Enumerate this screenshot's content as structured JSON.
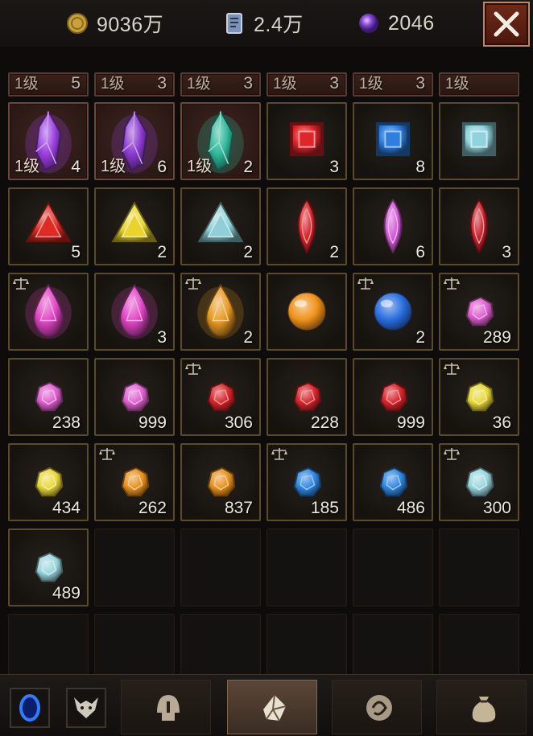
{
  "resources": {
    "gold": "9036万",
    "scroll": "2.4万",
    "orb": "2046"
  },
  "partial_row": [
    {
      "level": "1级",
      "qty": "5"
    },
    {
      "level": "1级",
      "qty": "3"
    },
    {
      "level": "1级",
      "qty": "3"
    },
    {
      "level": "1级",
      "qty": "3"
    },
    {
      "level": "1级",
      "qty": "3"
    },
    {
      "level": "1级",
      "qty": ""
    }
  ],
  "items": [
    {
      "name": "purple-crystal",
      "level": "1级",
      "qty": "4",
      "color": "#9b3fe0",
      "bound": false
    },
    {
      "name": "purple-crystal",
      "level": "1级",
      "qty": "6",
      "color": "#8a3ad0",
      "bound": false
    },
    {
      "name": "teal-crystal",
      "level": "1级",
      "qty": "2",
      "color": "#2fb89a",
      "bound": false
    },
    {
      "name": "red-square-gem",
      "level": "",
      "qty": "3",
      "color": "#e0262a",
      "bound": false
    },
    {
      "name": "blue-square-gem",
      "level": "",
      "qty": "8",
      "color": "#2f7fe0",
      "bound": false
    },
    {
      "name": "cyan-square-gem",
      "level": "",
      "qty": "",
      "color": "#8fd4dc",
      "bound": false
    },
    {
      "name": "red-triangle-gem",
      "level": "",
      "qty": "5",
      "color": "#e02a22",
      "bound": false
    },
    {
      "name": "yellow-triangle-gem",
      "level": "",
      "qty": "2",
      "color": "#e8d42c",
      "bound": false
    },
    {
      "name": "cyan-triangle-gem",
      "level": "",
      "qty": "2",
      "color": "#8fd0d8",
      "bound": false
    },
    {
      "name": "red-marquise-gem",
      "level": "",
      "qty": "2",
      "color": "#d8232a",
      "bound": false
    },
    {
      "name": "pink-marquise-gem",
      "level": "",
      "qty": "6",
      "color": "#d35ad8",
      "bound": false
    },
    {
      "name": "red-marquise-gem",
      "level": "",
      "qty": "3",
      "color": "#c8202a",
      "bound": false
    },
    {
      "name": "pink-pear-gem",
      "level": "",
      "qty": "",
      "color": "#e045c4",
      "bound": true
    },
    {
      "name": "pink-pear-gem",
      "level": "",
      "qty": "3",
      "color": "#e045c4",
      "bound": false
    },
    {
      "name": "amber-pear-gem",
      "level": "",
      "qty": "2",
      "color": "#e89a24",
      "bound": true
    },
    {
      "name": "amber-orb",
      "level": "",
      "qty": "",
      "color": "#f0921a",
      "bound": false
    },
    {
      "name": "blue-orb",
      "level": "",
      "qty": "2",
      "color": "#2a6ee0",
      "bound": true
    },
    {
      "name": "pink-rough-gem",
      "level": "",
      "qty": "289",
      "color": "#e060d0",
      "bound": true
    },
    {
      "name": "pink-rough-gem",
      "level": "",
      "qty": "238",
      "color": "#e060d0",
      "bound": false
    },
    {
      "name": "pink-rough-gem",
      "level": "",
      "qty": "999",
      "color": "#e060d0",
      "bound": false
    },
    {
      "name": "red-rough-gem",
      "level": "",
      "qty": "306",
      "color": "#d8242a",
      "bound": true
    },
    {
      "name": "red-rough-gem",
      "level": "",
      "qty": "228",
      "color": "#d8242a",
      "bound": false
    },
    {
      "name": "red-rough-gem",
      "level": "",
      "qty": "999",
      "color": "#d8242a",
      "bound": false
    },
    {
      "name": "yellow-rough-gem",
      "level": "",
      "qty": "36",
      "color": "#e8d83a",
      "bound": true
    },
    {
      "name": "yellow-rough-gem",
      "level": "",
      "qty": "434",
      "color": "#e8d83a",
      "bound": false
    },
    {
      "name": "amber-rough-gem",
      "level": "",
      "qty": "262",
      "color": "#e8901e",
      "bound": true
    },
    {
      "name": "amber-rough-gem",
      "level": "",
      "qty": "837",
      "color": "#e8901e",
      "bound": false
    },
    {
      "name": "blue-rough-gem",
      "level": "",
      "qty": "185",
      "color": "#2f86e0",
      "bound": true
    },
    {
      "name": "blue-rough-gem",
      "level": "",
      "qty": "486",
      "color": "#2f86e0",
      "bound": false
    },
    {
      "name": "cyan-rough-gem",
      "level": "",
      "qty": "300",
      "color": "#9ad6de",
      "bound": true
    },
    {
      "name": "cyan-rough-gem",
      "level": "",
      "qty": "489",
      "color": "#9ad6de",
      "bound": false
    }
  ],
  "tabs": [
    {
      "name": "helmet-tab-icon",
      "active": false
    },
    {
      "name": "gem-tab-icon",
      "active": true
    },
    {
      "name": "rune-tab-icon",
      "active": false
    },
    {
      "name": "bag-tab-icon",
      "active": false
    }
  ]
}
